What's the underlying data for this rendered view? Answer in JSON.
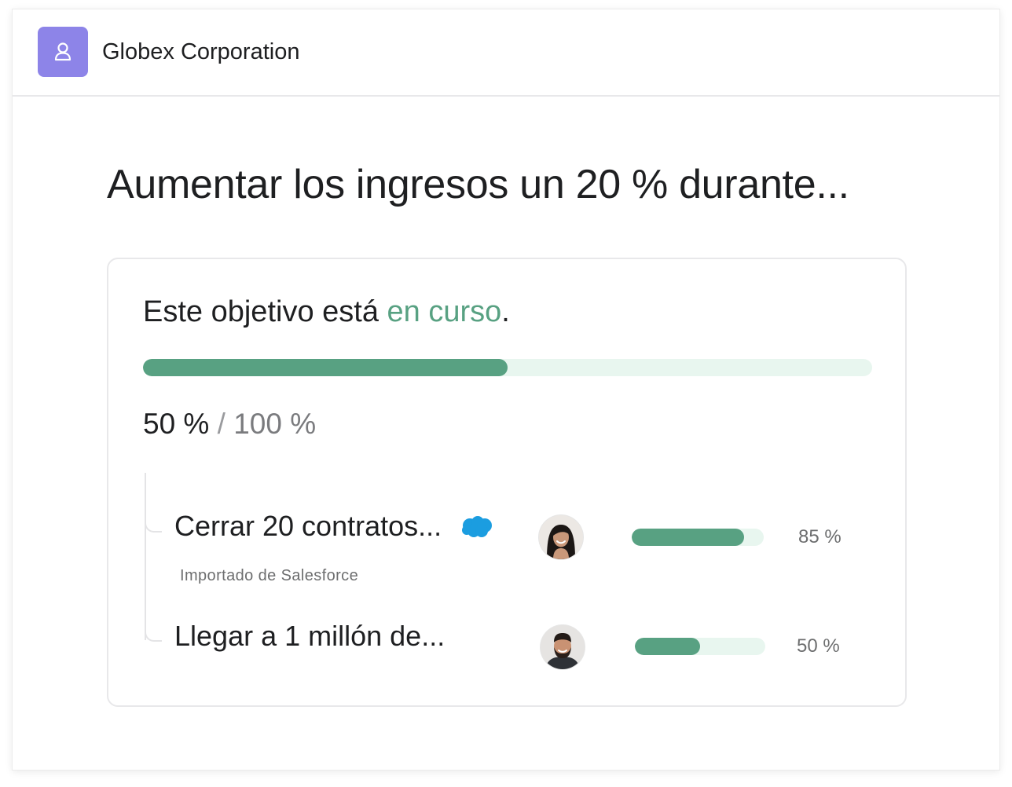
{
  "header": {
    "org_icon": "org-people-icon",
    "org_name": "Globex Corporation"
  },
  "goal": {
    "title": "Aumentar los ingresos un 20 % durante...",
    "status_prefix": "Este objetivo está ",
    "status_word": "en curso",
    "status_suffix": ".",
    "progress": 0.5,
    "progress_current": "50 %",
    "progress_separator": " / ",
    "progress_target": "100 %"
  },
  "sub_goals": [
    {
      "title": "Cerrar 20 contratos...",
      "source_icon": "salesforce-cloud-icon",
      "source": "Importado de Salesforce",
      "avatar": "woman-avatar",
      "progress": 0.85,
      "percent_label": "85 %"
    },
    {
      "title": "Llegar a 1 millón de...",
      "avatar": "man-avatar",
      "progress": 0.5,
      "percent_label": "50 %"
    }
  ],
  "colors": {
    "accent_green": "#58a182",
    "track_green": "#e8f6ef",
    "org_icon_bg": "#8d84e8",
    "salesforce_blue": "#1b9de0"
  }
}
